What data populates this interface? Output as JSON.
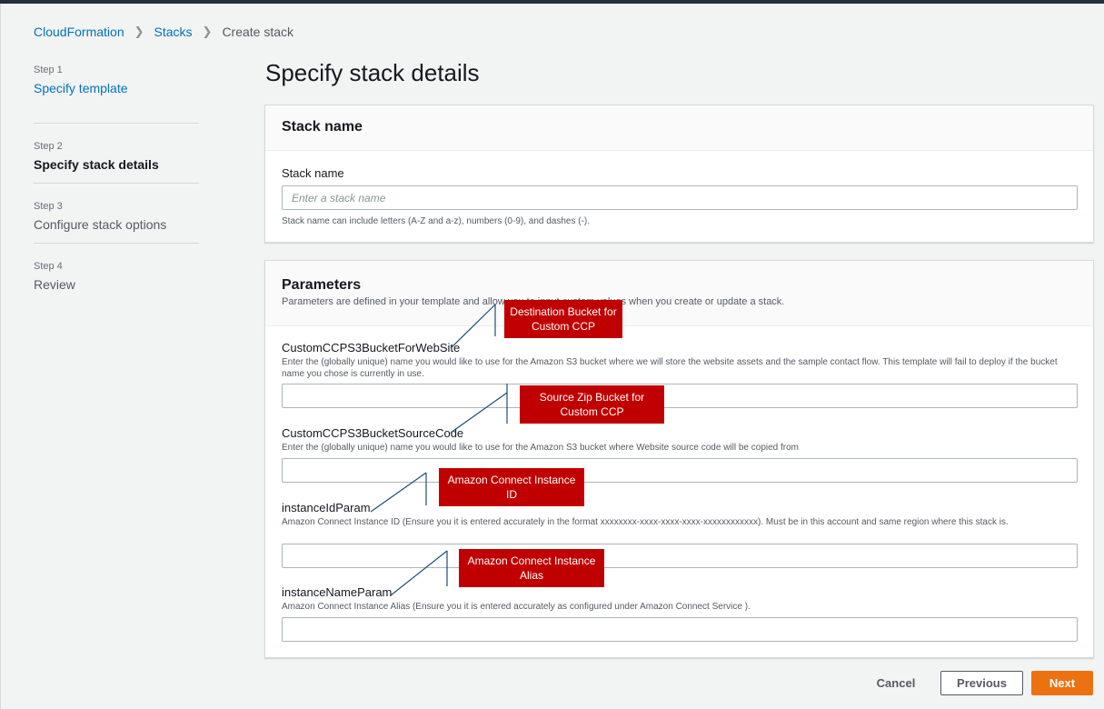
{
  "breadcrumb": {
    "items": [
      "CloudFormation",
      "Stacks"
    ],
    "current": "Create stack"
  },
  "steps": [
    {
      "number": "Step 1",
      "title": "Specify template"
    },
    {
      "number": "Step 2",
      "title": "Specify stack details"
    },
    {
      "number": "Step 3",
      "title": "Configure stack options"
    },
    {
      "number": "Step 4",
      "title": "Review"
    }
  ],
  "page_title": "Specify stack details",
  "stack_panel": {
    "heading": "Stack name",
    "label": "Stack name",
    "placeholder": "Enter a stack name",
    "value": "",
    "hint": "Stack name can include letters (A-Z and a-z), numbers (0-9), and dashes (-)."
  },
  "params_panel": {
    "heading": "Parameters",
    "description": "Parameters are defined in your template and allow you to input custom values when you create or update a stack.",
    "params": [
      {
        "name": "CustomCCPS3BucketForWebSite",
        "description": "Enter the (globally unique) name you would like to use for the Amazon S3 bucket where we will store the website assets and the sample contact flow. This template will fail to deploy if the bucket name you chose is currently in use.",
        "value": ""
      },
      {
        "name": "CustomCCPS3BucketSourceCode",
        "description": "Enter the (globally unique) name you would like to use for the Amazon S3 bucket where Website source code will be copied from",
        "value": ""
      },
      {
        "name": "instanceIdParam",
        "description": "Amazon Connect Instance ID (Ensure you it is entered accurately in the format xxxxxxxx-xxxx-xxxx-xxxx-xxxxxxxxxxxx). Must be in this account and same region where this stack is.",
        "value": ""
      },
      {
        "name": "instanceNameParam",
        "description": "Amazon Connect Instance Alias (Ensure you it is entered accurately as configured under Amazon Connect Service ).",
        "value": ""
      }
    ]
  },
  "callouts": [
    {
      "text": "Destination Bucket for Custom CCP"
    },
    {
      "text": "Source Zip Bucket for Custom CCP"
    },
    {
      "text": "Amazon Connect Instance ID"
    },
    {
      "text": "Amazon Connect Instance Alias"
    }
  ],
  "buttons": {
    "cancel": "Cancel",
    "previous": "Previous",
    "next": "Next"
  },
  "colors": {
    "link": "#0073bb",
    "primary": "#ec7211",
    "callout": "#c00000",
    "topbar": "#232f3e"
  }
}
